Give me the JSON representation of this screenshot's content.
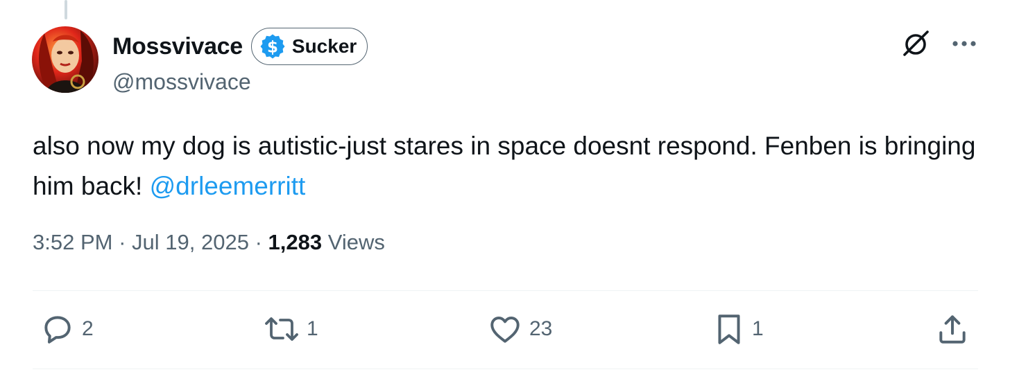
{
  "author": {
    "display_name": "Mossvivace",
    "handle": "@mossvivace",
    "badge_label": "Sucker",
    "badge_icon": "dollar-badge-icon"
  },
  "tweet": {
    "text_plain": "also now my dog is autistic-just stares in space doesnt respond. Fenben is bringing him back!",
    "mention": "@drleemerritt",
    "time": "3:52 PM",
    "separator": "·",
    "date": "Jul 19, 2025",
    "views_count": "1,283",
    "views_label": "Views"
  },
  "actions": {
    "replies": "2",
    "reposts": "1",
    "likes": "23",
    "bookmarks": "1"
  },
  "icons": {
    "top": [
      "grok-icon",
      "more-icon"
    ],
    "actions": [
      "reply-icon",
      "repost-icon",
      "like-icon",
      "bookmark-icon",
      "share-icon"
    ]
  },
  "colors": {
    "text": "#0f1419",
    "secondary": "#536471",
    "link": "#1d9bf0",
    "divider": "#eff3f4"
  }
}
